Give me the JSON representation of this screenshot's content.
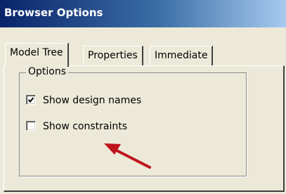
{
  "window": {
    "title": "Browser Options"
  },
  "tabs": [
    {
      "label": "Model Tree",
      "active": true
    },
    {
      "label": "Properties",
      "active": false
    },
    {
      "label": "Immediate",
      "active": false
    }
  ],
  "options_group": {
    "legend": "Options",
    "items": [
      {
        "label": "Show design names",
        "checked": true
      },
      {
        "label": "Show constraints",
        "checked": false
      }
    ]
  },
  "colors": {
    "title_bar_start": "#0a246a",
    "title_bar_end": "#a6caf0",
    "dialog_background": "#ece9d8",
    "annotation_arrow": "#c0141c"
  },
  "annotation": {
    "type": "arrow",
    "points_to": "Show constraints"
  }
}
